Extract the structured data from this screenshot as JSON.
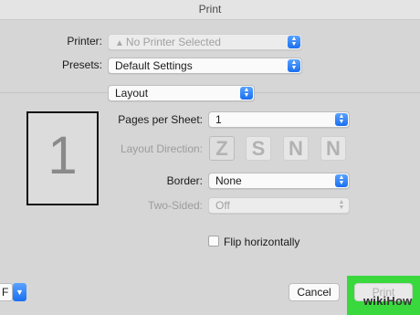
{
  "window": {
    "title": "Print"
  },
  "printer": {
    "label": "Printer:",
    "value": "No Printer Selected",
    "warning_icon": "warning-triangle-icon"
  },
  "presets": {
    "label": "Presets:",
    "value": "Default Settings"
  },
  "section": {
    "value": "Layout"
  },
  "preview": {
    "page_number": "1"
  },
  "pages_per_sheet": {
    "label": "Pages per Sheet:",
    "value": "1"
  },
  "layout_direction": {
    "label": "Layout Direction:",
    "options": [
      "Z",
      "S",
      "N",
      "N"
    ]
  },
  "border": {
    "label": "Border:",
    "value": "None"
  },
  "two_sided": {
    "label": "Two-Sided:",
    "value": "Off"
  },
  "flip": {
    "label": "Flip horizontally",
    "checked": false
  },
  "pdf": {
    "label": "F"
  },
  "buttons": {
    "cancel": "Cancel",
    "print": "Print"
  },
  "watermark": {
    "part1": "wiki",
    "part2": "How"
  },
  "colors": {
    "accent": "#1a6ff0",
    "highlight": "#39d93e"
  }
}
